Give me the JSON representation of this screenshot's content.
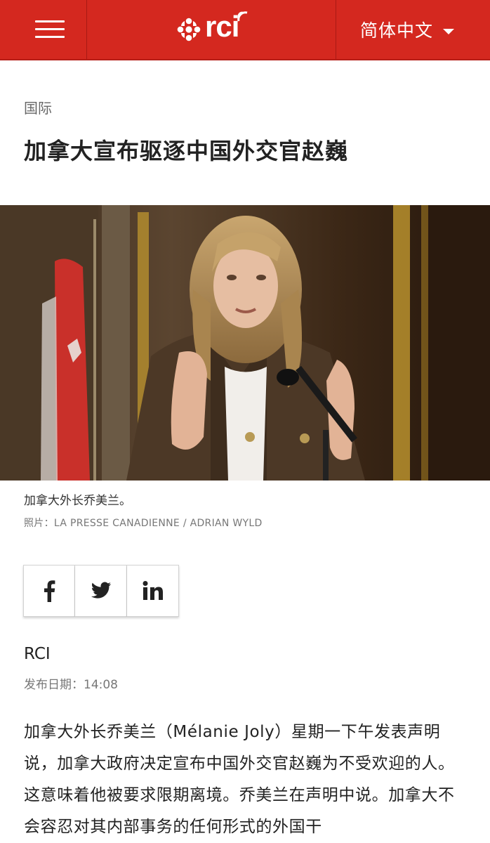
{
  "header": {
    "menu_icon": "hamburger-menu-icon",
    "logo_text": "rci",
    "language": "简体中文",
    "brand_color": "#d4281f"
  },
  "article": {
    "category": "国际",
    "title": "加拿大宣布驱逐中国外交官赵巍",
    "image": {
      "caption": "加拿大外长乔美兰。",
      "credit": "照片：LA PRESSE CANADIENNE / ADRIAN WYLD"
    },
    "share": [
      {
        "network": "facebook",
        "icon": "facebook-icon"
      },
      {
        "network": "twitter",
        "icon": "twitter-icon"
      },
      {
        "network": "linkedin",
        "icon": "linkedin-icon"
      }
    ],
    "author": "RCI",
    "date_label": "发布日期：",
    "date_value": "14:08",
    "body": "加拿大外长乔美兰（Mélanie Joly）星期一下午发表声明说，加拿大政府决定宣布中国外交官赵巍为不受欢迎的人。这意味着他被要求限期离境。乔美兰在声明中说。加拿大不会容忍对其内部事务的任何形式的外国干"
  }
}
